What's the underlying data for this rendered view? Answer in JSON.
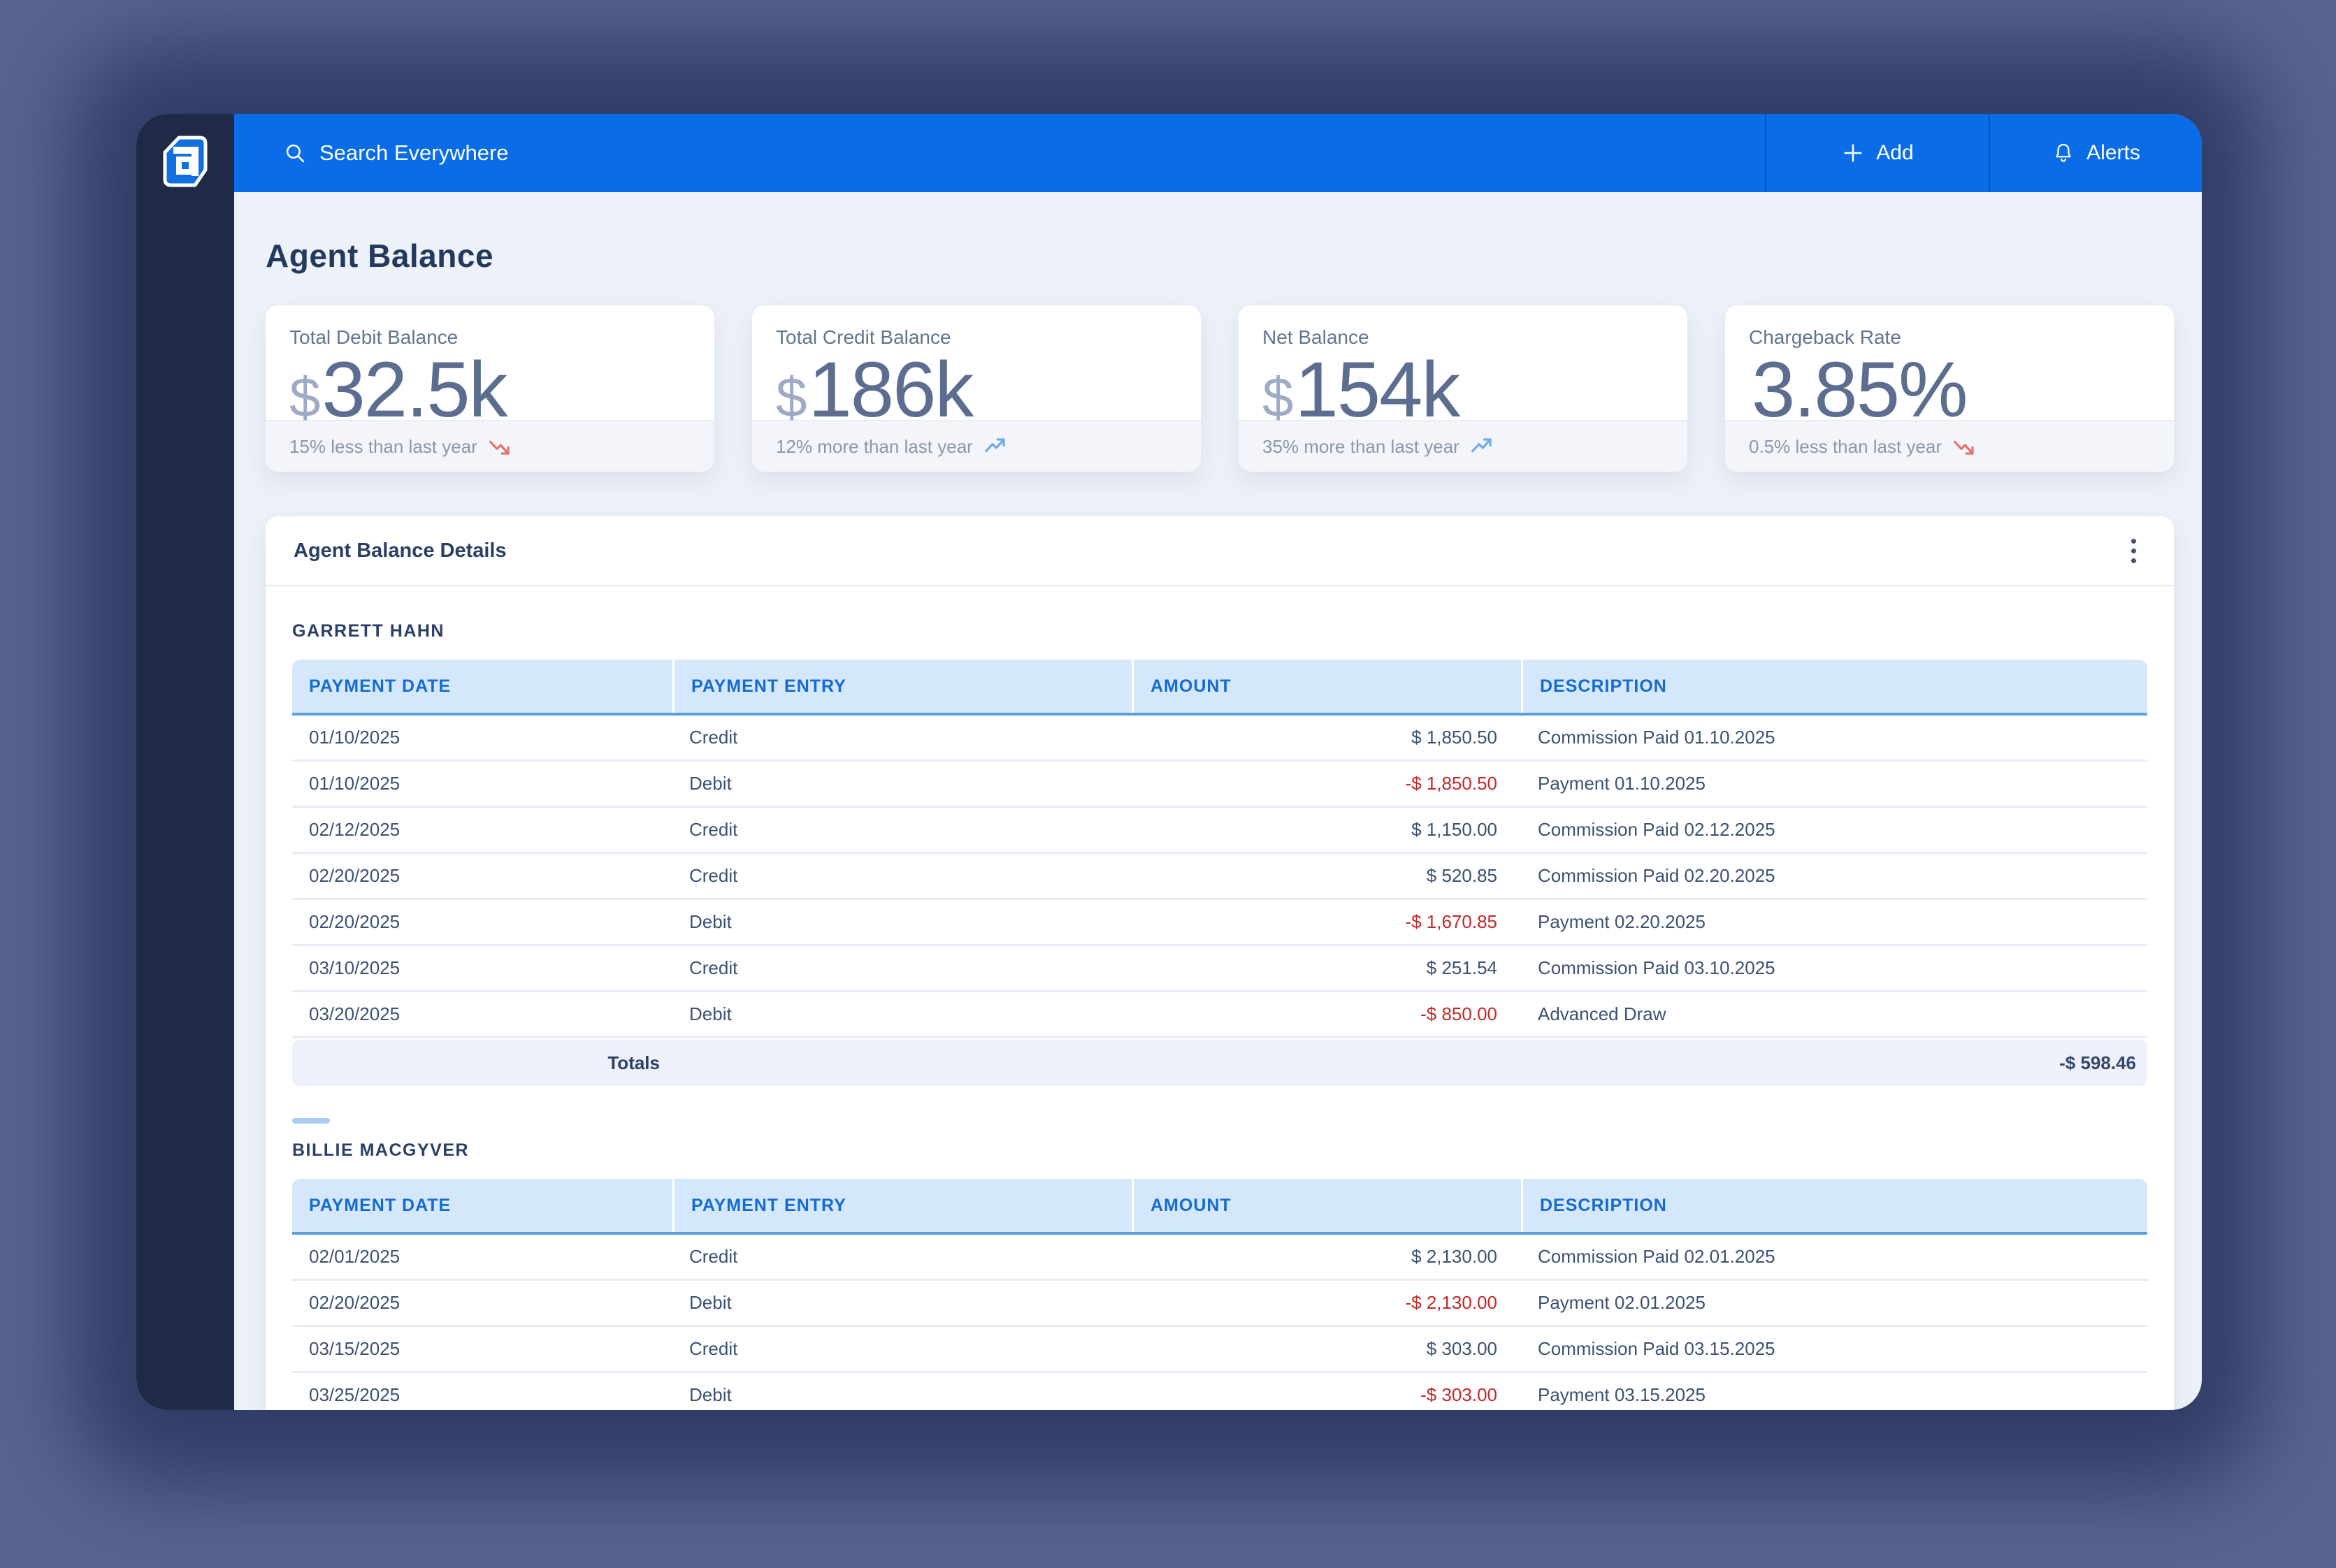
{
  "topbar": {
    "search_placeholder": "Search Everywhere",
    "add_label": "Add",
    "alerts_label": "Alerts"
  },
  "page": {
    "title": "Agent Balance"
  },
  "stats": [
    {
      "label": "Total Debit Balance",
      "prefix": "$",
      "value": "32.5k",
      "footnote": "15% less than last year",
      "trend": "down"
    },
    {
      "label": "Total Credit Balance",
      "prefix": "$",
      "value": "186k",
      "footnote": "12% more than last year",
      "trend": "up"
    },
    {
      "label": "Net Balance",
      "prefix": "$",
      "value": "154k",
      "footnote": "35% more than last year",
      "trend": "up"
    },
    {
      "label": "Chargeback Rate",
      "prefix": "",
      "value": "3.85%",
      "footnote": "0.5% less than last year",
      "trend": "down"
    }
  ],
  "details": {
    "title": "Agent Balance Details",
    "columns": [
      "PAYMENT DATE",
      "PAYMENT ENTRY",
      "AMOUNT",
      "DESCRIPTION"
    ],
    "sections": [
      {
        "name": "GARRETT HAHN",
        "rows": [
          {
            "date": "01/10/2025",
            "entry": "Credit",
            "amount": "$ 1,850.50",
            "negative": false,
            "description": "Commission Paid 01.10.2025"
          },
          {
            "date": "01/10/2025",
            "entry": "Debit",
            "amount": "-$ 1,850.50",
            "negative": true,
            "description": "Payment 01.10.2025"
          },
          {
            "date": "02/12/2025",
            "entry": "Credit",
            "amount": "$ 1,150.00",
            "negative": false,
            "description": "Commission Paid 02.12.2025"
          },
          {
            "date": "02/20/2025",
            "entry": "Credit",
            "amount": "$ 520.85",
            "negative": false,
            "description": "Commission Paid 02.20.2025"
          },
          {
            "date": "02/20/2025",
            "entry": "Debit",
            "amount": "-$ 1,670.85",
            "negative": true,
            "description": "Payment 02.20.2025"
          },
          {
            "date": "03/10/2025",
            "entry": "Credit",
            "amount": "$ 251.54",
            "negative": false,
            "description": "Commission Paid 03.10.2025"
          },
          {
            "date": "03/20/2025",
            "entry": "Debit",
            "amount": "-$ 850.00",
            "negative": true,
            "description": "Advanced Draw"
          }
        ],
        "totals_label": "Totals",
        "totals_value": "-$ 598.46"
      },
      {
        "name": "BILLIE MACGYVER",
        "rows": [
          {
            "date": "02/01/2025",
            "entry": "Credit",
            "amount": "$ 2,130.00",
            "negative": false,
            "description": "Commission Paid 02.01.2025"
          },
          {
            "date": "02/20/2025",
            "entry": "Debit",
            "amount": "-$ 2,130.00",
            "negative": true,
            "description": "Payment 02.01.2025"
          },
          {
            "date": "03/15/2025",
            "entry": "Credit",
            "amount": "$ 303.00",
            "negative": false,
            "description": "Commission Paid 03.15.2025"
          },
          {
            "date": "03/25/2025",
            "entry": "Debit",
            "amount": "-$ 303.00",
            "negative": true,
            "description": "Payment 03.15.2025"
          }
        ],
        "totals_label": null,
        "totals_value": null
      }
    ]
  },
  "colors": {
    "brand_blue": "#0b6ce8",
    "sidebar_navy": "#1e2a46",
    "negative_red": "#c62828",
    "trend_up": "#70abf0",
    "trend_down": "#e4736e",
    "table_header_text": "#146bd2",
    "table_header_bg": "#d4e7fb"
  }
}
